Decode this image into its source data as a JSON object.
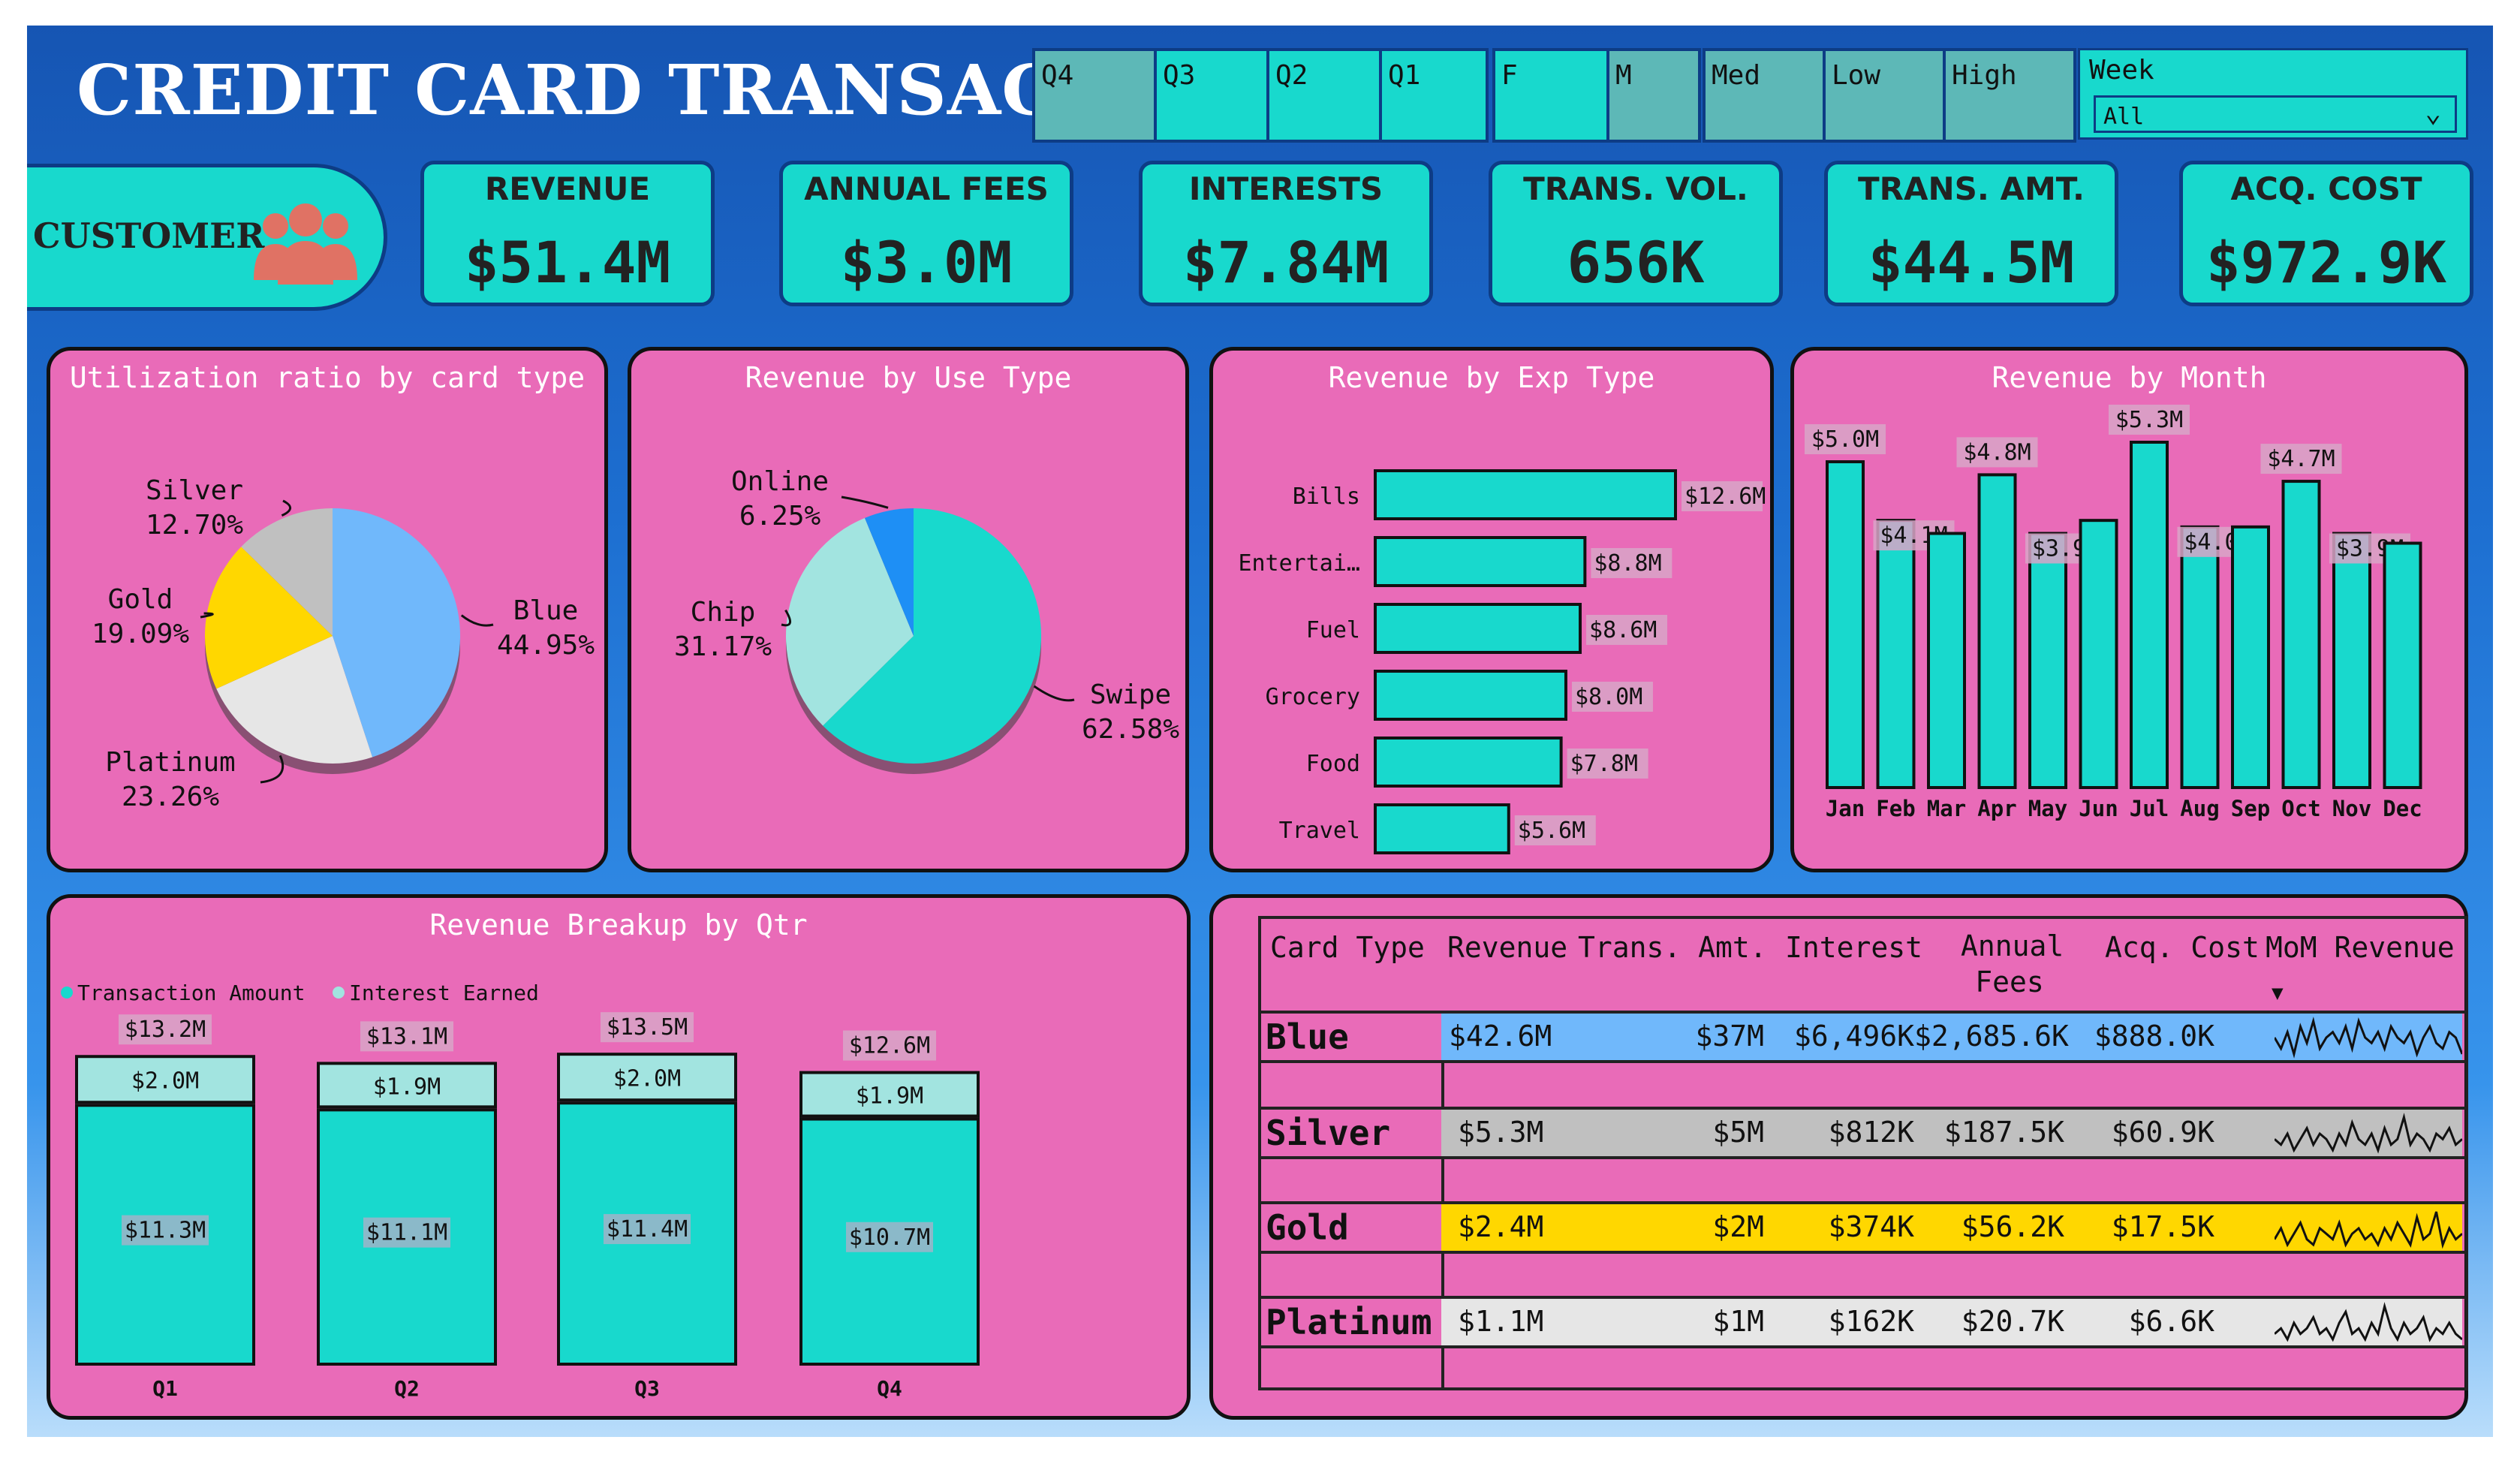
{
  "header": {
    "title": "CREDIT CARD TRANSACTION"
  },
  "slicers": {
    "quarters": [
      "Q4",
      "Q3",
      "Q2",
      "Q1"
    ],
    "gender": [
      "F",
      "M"
    ],
    "levels": [
      "Med",
      "Low",
      "High"
    ],
    "week": {
      "label": "Week",
      "value": "All"
    }
  },
  "customer": {
    "label": "CUSTOMER",
    "icon": "people-group-icon"
  },
  "kpis": [
    {
      "label": "REVENUE",
      "value": "$51.4M"
    },
    {
      "label": "ANNUAL FEES",
      "value": "$3.0M"
    },
    {
      "label": "INTERESTS",
      "value": "$7.84M"
    },
    {
      "label": "TRANS. VOL.",
      "value": "656K"
    },
    {
      "label": "TRANS. AMT.",
      "value": "$44.5M"
    },
    {
      "label": "ACQ. COST",
      "value": "$972.9K"
    }
  ],
  "colors": {
    "teal": "#18d9cd",
    "pink": "#e96bb8",
    "blue": "#70b8fb",
    "silver": "#c0c0c0",
    "gold": "#ffd700",
    "platinum": "#e6e6e6",
    "lightTeal": "#a2e4e0",
    "dodger": "#1e8ff5"
  },
  "chart_data": [
    {
      "type": "pie",
      "title": "Utilization ratio by card type",
      "slices": [
        {
          "label": "Blue",
          "value": 44.95,
          "text": "44.95%"
        },
        {
          "label": "Platinum",
          "value": 23.26,
          "text": "23.26%"
        },
        {
          "label": "Gold",
          "value": 19.09,
          "text": "19.09%"
        },
        {
          "label": "Silver",
          "value": 12.7,
          "text": "12.70%"
        }
      ]
    },
    {
      "type": "pie",
      "title": "Revenue by Use Type",
      "slices": [
        {
          "label": "Swipe",
          "value": 62.58,
          "text": "62.58%"
        },
        {
          "label": "Chip",
          "value": 31.17,
          "text": "31.17%"
        },
        {
          "label": "Online",
          "value": 6.25,
          "text": "6.25%"
        }
      ]
    },
    {
      "type": "bar",
      "orientation": "horizontal",
      "title": "Revenue by Exp Type",
      "categories": [
        "Bills",
        "Entertai…",
        "Fuel",
        "Grocery",
        "Food",
        "Travel"
      ],
      "values": [
        12.6,
        8.8,
        8.6,
        8.0,
        7.8,
        5.6
      ],
      "labels": [
        "$12.6M",
        "$8.8M",
        "$8.6M",
        "$8.0M",
        "$7.8M",
        "$5.6M"
      ]
    },
    {
      "type": "bar",
      "title": "Revenue by Month",
      "categories": [
        "Jan",
        "Feb",
        "Mar",
        "Apr",
        "May",
        "Jun",
        "Jul",
        "Aug",
        "Sep",
        "Oct",
        "Nov",
        "Dec"
      ],
      "values": [
        5.0,
        4.1,
        3.9,
        4.8,
        3.9,
        4.1,
        5.3,
        4.0,
        4.0,
        4.7,
        3.9,
        3.75
      ],
      "labels": [
        "$5.0M",
        "$4.1M",
        "",
        "$4.8M",
        "$3.9M",
        "",
        "$5.3M",
        "$4.0M",
        "",
        "$4.7M",
        "$3.9M",
        ""
      ]
    },
    {
      "type": "bar",
      "stacked": true,
      "title": "Revenue Breakup by Qtr",
      "categories": [
        "Q1",
        "Q2",
        "Q3",
        "Q4"
      ],
      "series": [
        {
          "name": "Transaction Amount",
          "values": [
            11.3,
            11.1,
            11.4,
            10.7
          ],
          "labels": [
            "$11.3M",
            "$11.1M",
            "$11.4M",
            "$10.7M"
          ]
        },
        {
          "name": "Interest Earned",
          "values": [
            2.0,
            1.9,
            2.0,
            1.9
          ],
          "labels": [
            "$2.0M",
            "$1.9M",
            "$2.0M",
            "$1.9M"
          ]
        }
      ],
      "totals": [
        "$13.2M",
        "$13.1M",
        "$13.5M",
        "$12.6M"
      ]
    }
  ],
  "table": {
    "headers": [
      "Card Type",
      "Revenue",
      "Trans. Amt.",
      "Interest",
      "Annual Fees",
      "Acq. Cost",
      "MoM Revenue"
    ],
    "sort_indicator": "▼",
    "rows": [
      {
        "name": "Blue",
        "revenue": "$42.6M",
        "trans": "$37M",
        "interest": "$6,496K",
        "fees": "$2,685.6K",
        "acq": "$888.0K",
        "spark": [
          6,
          4,
          7,
          3,
          8,
          5,
          9,
          4,
          6,
          7,
          5,
          8,
          4,
          9,
          6,
          5,
          7,
          4,
          8,
          6,
          5,
          7,
          3,
          6,
          8,
          5,
          4,
          7,
          6,
          3
        ]
      },
      {
        "name": "Silver",
        "revenue": "$5.3M",
        "trans": "$5M",
        "interest": "$812K",
        "fees": "$187.5K",
        "acq": "$60.9K",
        "spark": [
          5,
          4,
          6,
          3,
          5,
          7,
          4,
          6,
          5,
          3,
          6,
          4,
          8,
          5,
          4,
          6,
          3,
          7,
          4,
          5,
          9,
          4,
          6,
          5,
          3,
          6,
          5,
          7,
          4,
          5
        ]
      },
      {
        "name": "Gold",
        "revenue": "$2.4M",
        "trans": "$2M",
        "interest": "$374K",
        "fees": "$56.2K",
        "acq": "$17.5K",
        "spark": [
          4,
          6,
          3,
          5,
          7,
          4,
          3,
          6,
          5,
          4,
          7,
          3,
          5,
          6,
          4,
          5,
          3,
          6,
          4,
          7,
          5,
          3,
          8,
          4,
          5,
          9,
          3,
          6,
          4,
          5
        ]
      },
      {
        "name": "Platinum",
        "revenue": "$1.1M",
        "trans": "$1M",
        "interest": "$162K",
        "fees": "$20.7K",
        "acq": "$6.6K",
        "spark": [
          4,
          5,
          3,
          6,
          4,
          5,
          7,
          4,
          5,
          3,
          6,
          8,
          4,
          5,
          3,
          6,
          4,
          9,
          5,
          3,
          6,
          4,
          5,
          7,
          3,
          5,
          4,
          6,
          4,
          3
        ]
      }
    ]
  }
}
